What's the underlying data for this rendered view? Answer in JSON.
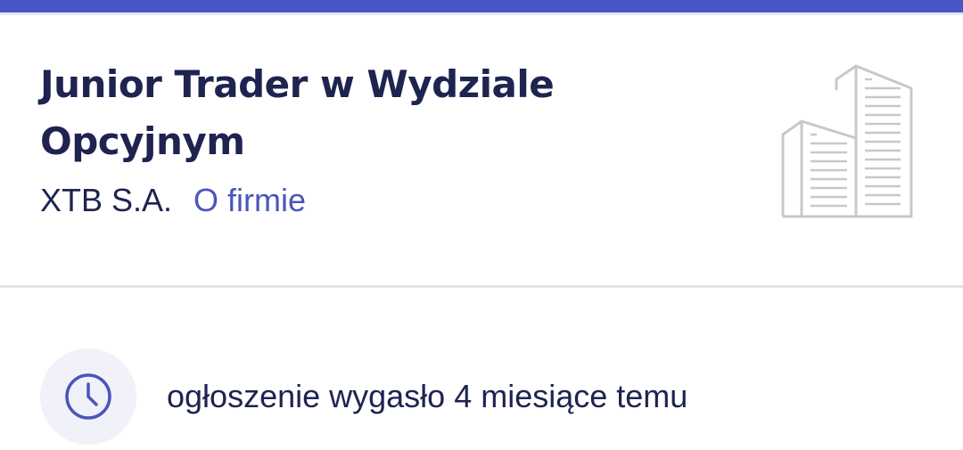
{
  "job": {
    "title": "Junior Trader w Wydziale Opcyjnym",
    "company": "XTB S.A.",
    "company_link": "O firmie"
  },
  "status": {
    "text": "ogłoszenie wygasło 4 miesiące temu",
    "icon": "clock-icon"
  },
  "header": {
    "icon": "building-icon"
  },
  "colors": {
    "accent": "#4a56c7",
    "title": "#1e2350",
    "link": "#4a56b8",
    "icon_gray": "#c8c8c8",
    "clock_bg": "#f0f1f9"
  }
}
